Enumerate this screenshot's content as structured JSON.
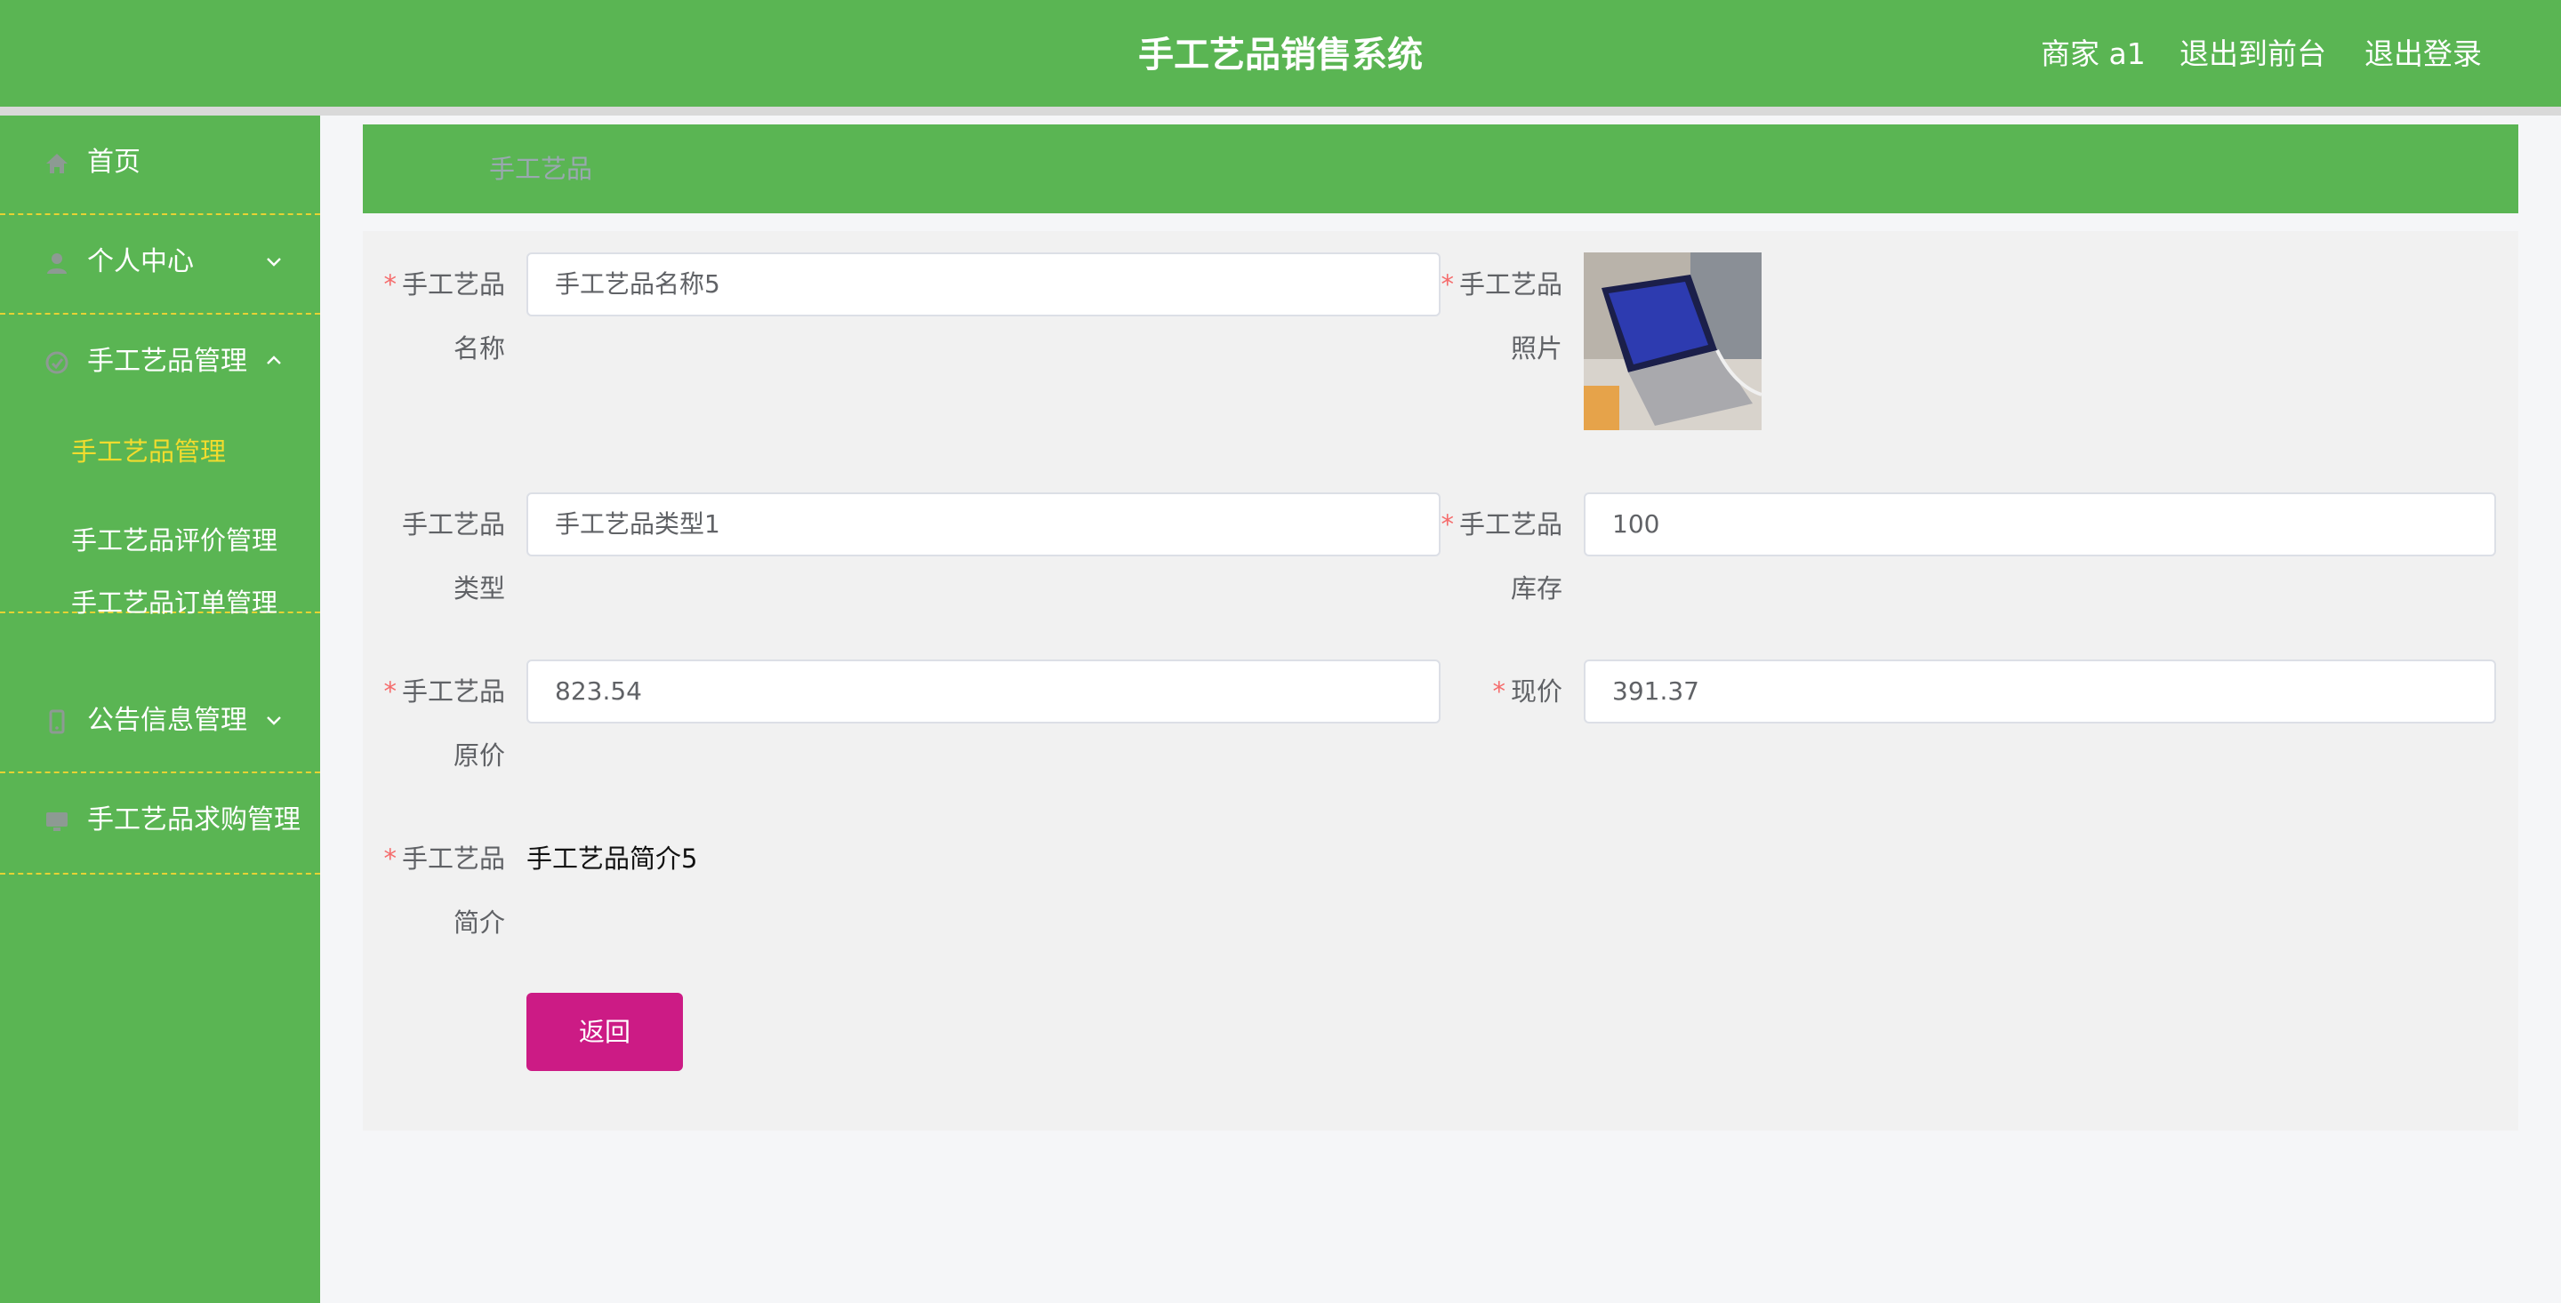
{
  "header": {
    "title": "手工艺品销售系统",
    "user_label": "商家 a1",
    "to_frontend": "退出到前台",
    "logout": "退出登录"
  },
  "sidebar": {
    "items": [
      {
        "label": "首页",
        "icon": "home-icon"
      },
      {
        "label": "个人中心",
        "icon": "user-icon",
        "expanded": false
      },
      {
        "label": "手工艺品管理",
        "icon": "craft-icon",
        "expanded": true,
        "children": [
          {
            "label": "手工艺品管理",
            "active": true
          },
          {
            "label": "手工艺品评价管理",
            "active": false
          },
          {
            "label": "手工艺品订单管理",
            "active": false
          }
        ]
      },
      {
        "label": "公告信息管理",
        "icon": "notice-icon",
        "expanded": false
      },
      {
        "label": "手工艺品求购管理",
        "icon": "monitor-icon"
      }
    ]
  },
  "breadcrumb": {
    "current": "手工艺品"
  },
  "form": {
    "name": {
      "label_line1": "手工艺品",
      "label_line2": "名称",
      "value": "手工艺品名称5",
      "required": true
    },
    "photo": {
      "label_line1": "手工艺品",
      "label_line2": "照片",
      "required": true
    },
    "type": {
      "label_line1": "手工艺品",
      "label_line2": "类型",
      "value": "手工艺品类型1",
      "required": false
    },
    "stock": {
      "label_line1": "手工艺品",
      "label_line2": "库存",
      "value": "100",
      "required": true
    },
    "original_price": {
      "label_line1": "手工艺品",
      "label_line2": "原价",
      "value": "823.54",
      "required": true
    },
    "current_price": {
      "label": "现价",
      "value": "391.37",
      "required": true
    },
    "intro": {
      "label_line1": "手工艺品",
      "label_line2": "简介",
      "value": "手工艺品简介5",
      "required": true
    },
    "back_label": "返回",
    "required_mark": "*"
  },
  "colors": {
    "primary_green": "#5ab553",
    "active_menu_text": "#f2dc2e",
    "back_button": "#cc1b85",
    "required": "#f56c6c",
    "divider_dash": "#e6d233"
  }
}
